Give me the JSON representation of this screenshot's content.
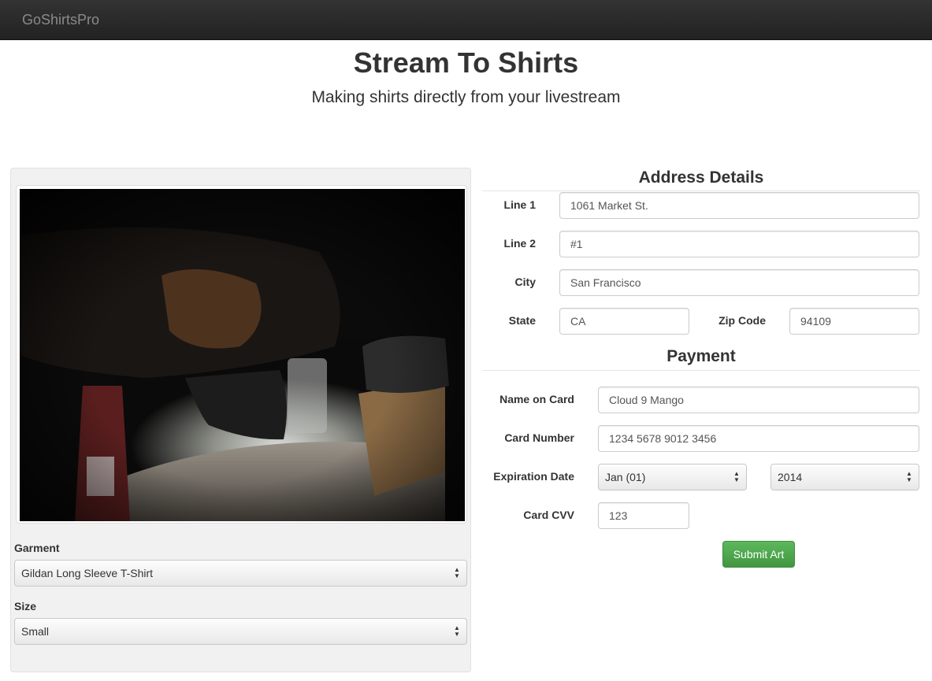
{
  "navbar": {
    "brand": "GoShirtsPro"
  },
  "hero": {
    "title": "Stream To Shirts",
    "subtitle": "Making shirts directly from your livestream"
  },
  "left_panel": {
    "garment": {
      "label": "Garment",
      "selected": "Gildan Long Sleeve T-Shirt"
    },
    "size": {
      "label": "Size",
      "selected": "Small"
    }
  },
  "address": {
    "title": "Address Details",
    "line1": {
      "label": "Line 1",
      "value": "1061 Market St."
    },
    "line2": {
      "label": "Line 2",
      "value": "#1"
    },
    "city": {
      "label": "City",
      "value": "San Francisco"
    },
    "state": {
      "label": "State",
      "value": "CA"
    },
    "zip": {
      "label": "Zip Code",
      "value": "94109"
    }
  },
  "payment": {
    "title": "Payment",
    "name": {
      "label": "Name on Card",
      "value": "Cloud 9 Mango"
    },
    "number": {
      "label": "Card Number",
      "value": "1234 5678 9012 3456"
    },
    "expiration": {
      "label": "Expiration Date",
      "month": "Jan (01)",
      "year": "2014"
    },
    "cvv": {
      "label": "Card CVV",
      "value": "123"
    },
    "submit_label": "Submit Art"
  },
  "colors": {
    "navbar": "#222222",
    "submit": "#5cb85c",
    "well": "#f1f1f1"
  }
}
